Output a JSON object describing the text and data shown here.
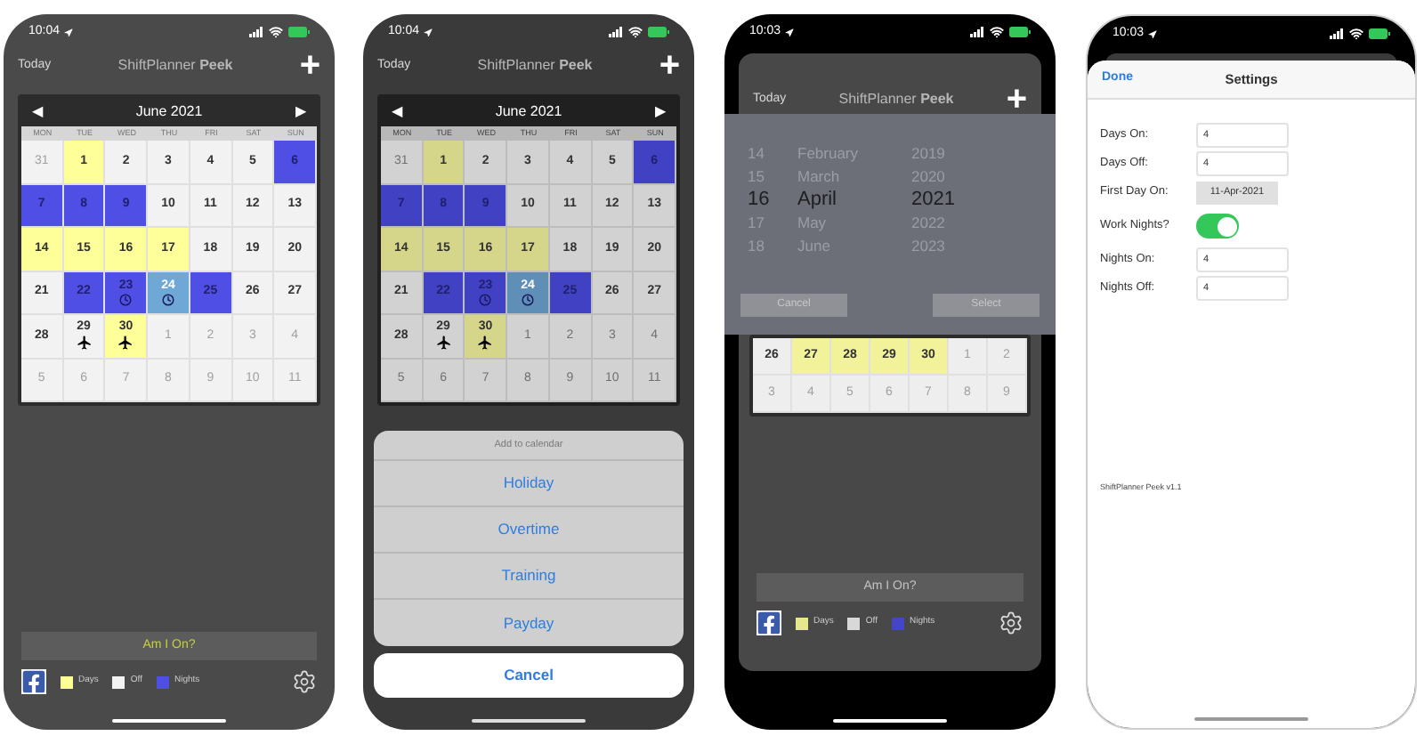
{
  "phones": [
    {
      "kind": "calendar",
      "status": {
        "time": "10:04"
      },
      "nav": {
        "left": "Today",
        "title": "ShiftPlanner **Peek**",
        "right": "+"
      },
      "calendar": {
        "prev": "◀",
        "month": "June 2021",
        "next": "▶",
        "weekdays": [
          "MON",
          "TUE",
          "WED",
          "THU",
          "FRI",
          "SAT",
          "SUN"
        ],
        "cells": [
          {
            "day": "31",
            "color": "#f2f2f2",
            "muted": true
          },
          {
            "day": "1",
            "color": "#ffff99",
            "muted": false
          },
          {
            "day": "2",
            "color": "#f2f2f2",
            "muted": false
          },
          {
            "day": "3",
            "color": "#f2f2f2",
            "muted": false
          },
          {
            "day": "4",
            "color": "#f2f2f2",
            "muted": false
          },
          {
            "day": "5",
            "color": "#f2f2f2",
            "muted": false
          },
          {
            "day": "6",
            "color": "#4f4fe6",
            "muted": false
          },
          {
            "day": "7",
            "color": "#4f4fe6",
            "muted": false
          },
          {
            "day": "8",
            "color": "#4f4fe6",
            "muted": false
          },
          {
            "day": "9",
            "color": "#4f4fe6",
            "muted": false
          },
          {
            "day": "10",
            "color": "#f2f2f2",
            "muted": false
          },
          {
            "day": "11",
            "color": "#f2f2f2",
            "muted": false
          },
          {
            "day": "12",
            "color": "#f2f2f2",
            "muted": false
          },
          {
            "day": "13",
            "color": "#f2f2f2",
            "muted": false
          },
          {
            "day": "14",
            "color": "#ffff99",
            "muted": false
          },
          {
            "day": "15",
            "color": "#ffff99",
            "muted": false
          },
          {
            "day": "16",
            "color": "#ffff99",
            "muted": false
          },
          {
            "day": "17",
            "color": "#ffff99",
            "muted": false
          },
          {
            "day": "18",
            "color": "#f2f2f2",
            "muted": false
          },
          {
            "day": "19",
            "color": "#f2f2f2",
            "muted": false
          },
          {
            "day": "20",
            "color": "#f2f2f2",
            "muted": false
          },
          {
            "day": "21",
            "color": "#f2f2f2",
            "muted": false
          },
          {
            "day": "22",
            "color": "#4f4fe6",
            "muted": false
          },
          {
            "day": "23",
            "color": "#4f4fe6",
            "muted": false,
            "kind": "clock"
          },
          {
            "day": "24",
            "color": "#6fa8d6",
            "muted": false,
            "kind": "clock"
          },
          {
            "day": "25",
            "color": "#4f4fe6",
            "muted": false
          },
          {
            "day": "26",
            "color": "#f2f2f2",
            "muted": false
          },
          {
            "day": "27",
            "color": "#f2f2f2",
            "muted": false
          },
          {
            "day": "28",
            "color": "#f2f2f2",
            "muted": false
          },
          {
            "day": "29",
            "color": "#f2f2f2",
            "muted": false,
            "kind": "plane"
          },
          {
            "day": "30",
            "color": "#ffff99",
            "muted": false,
            "kind": "plane"
          },
          {
            "day": "1",
            "color": "#f2f2f2",
            "muted": true
          },
          {
            "day": "2",
            "color": "#f2f2f2",
            "muted": true
          },
          {
            "day": "3",
            "color": "#f2f2f2",
            "muted": true
          },
          {
            "day": "4",
            "color": "#f2f2f2",
            "muted": true
          },
          {
            "day": "5",
            "color": "#f2f2f2",
            "muted": true
          },
          {
            "day": "6",
            "color": "#f2f2f2",
            "muted": true
          },
          {
            "day": "7",
            "color": "#f2f2f2",
            "muted": true
          },
          {
            "day": "8",
            "color": "#f2f2f2",
            "muted": true
          },
          {
            "day": "9",
            "color": "#f2f2f2",
            "muted": true
          },
          {
            "day": "10",
            "color": "#f2f2f2",
            "muted": true
          },
          {
            "day": "11",
            "color": "#f2f2f2",
            "muted": true
          }
        ]
      },
      "button": "Am I On?",
      "legend": [
        {
          "label": "Days",
          "color": "#ffff99"
        },
        {
          "label": "Off",
          "color": "#f2f2f2"
        },
        {
          "label": "Nights",
          "color": "#4f4fe6"
        }
      ]
    },
    {
      "kind": "action_sheet",
      "status": {
        "time": "10:04"
      },
      "nav": {
        "left": "Today",
        "title": "ShiftPlanner **Peek**",
        "right": "+"
      },
      "calendar": {
        "prev": "◀",
        "month": "June 2021",
        "next": "▶",
        "weekdays": [
          "MON",
          "TUE",
          "WED",
          "THU",
          "FRI",
          "SAT",
          "SUN"
        ],
        "cells": [
          {
            "day": "31",
            "color": "#d2d2d2",
            "muted": true
          },
          {
            "day": "1",
            "color": "#d6d68a",
            "muted": false
          },
          {
            "day": "2",
            "color": "#d2d2d2",
            "muted": false
          },
          {
            "day": "3",
            "color": "#d2d2d2",
            "muted": false
          },
          {
            "day": "4",
            "color": "#d2d2d2",
            "muted": false
          },
          {
            "day": "5",
            "color": "#d2d2d2",
            "muted": false
          },
          {
            "day": "6",
            "color": "#4141c4",
            "muted": false
          },
          {
            "day": "7",
            "color": "#4141c4",
            "muted": false
          },
          {
            "day": "8",
            "color": "#4141c4",
            "muted": false
          },
          {
            "day": "9",
            "color": "#4141c4",
            "muted": false
          },
          {
            "day": "10",
            "color": "#d2d2d2",
            "muted": false
          },
          {
            "day": "11",
            "color": "#d2d2d2",
            "muted": false
          },
          {
            "day": "12",
            "color": "#d2d2d2",
            "muted": false
          },
          {
            "day": "13",
            "color": "#d2d2d2",
            "muted": false
          },
          {
            "day": "14",
            "color": "#d6d68a",
            "muted": false
          },
          {
            "day": "15",
            "color": "#d6d68a",
            "muted": false
          },
          {
            "day": "16",
            "color": "#d6d68a",
            "muted": false
          },
          {
            "day": "17",
            "color": "#d6d68a",
            "muted": false
          },
          {
            "day": "18",
            "color": "#d2d2d2",
            "muted": false
          },
          {
            "day": "19",
            "color": "#d2d2d2",
            "muted": false
          },
          {
            "day": "20",
            "color": "#d2d2d2",
            "muted": false
          },
          {
            "day": "21",
            "color": "#d2d2d2",
            "muted": false
          },
          {
            "day": "22",
            "color": "#4141c4",
            "muted": false
          },
          {
            "day": "23",
            "color": "#4141c4",
            "muted": false,
            "kind": "clock"
          },
          {
            "day": "24",
            "color": "#5f8fb6",
            "muted": false,
            "kind": "clock"
          },
          {
            "day": "25",
            "color": "#4141c4",
            "muted": false
          },
          {
            "day": "26",
            "color": "#d2d2d2",
            "muted": false
          },
          {
            "day": "27",
            "color": "#d2d2d2",
            "muted": false
          },
          {
            "day": "28",
            "color": "#d2d2d2",
            "muted": false
          },
          {
            "day": "29",
            "color": "#d2d2d2",
            "muted": false,
            "kind": "plane"
          },
          {
            "day": "30",
            "color": "#d6d68a",
            "muted": false,
            "kind": "plane"
          },
          {
            "day": "1",
            "color": "#d2d2d2",
            "muted": true
          },
          {
            "day": "2",
            "color": "#d2d2d2",
            "muted": true
          },
          {
            "day": "3",
            "color": "#d2d2d2",
            "muted": true
          },
          {
            "day": "4",
            "color": "#d2d2d2",
            "muted": true
          },
          {
            "day": "5",
            "color": "#d2d2d2",
            "muted": true
          },
          {
            "day": "6",
            "color": "#d2d2d2",
            "muted": true
          },
          {
            "day": "7",
            "color": "#d2d2d2",
            "muted": true
          },
          {
            "day": "8",
            "color": "#d2d2d2",
            "muted": true
          },
          {
            "day": "9",
            "color": "#d2d2d2",
            "muted": true
          },
          {
            "day": "10",
            "color": "#d2d2d2",
            "muted": true
          },
          {
            "day": "11",
            "color": "#d2d2d2",
            "muted": true
          }
        ]
      },
      "sheet": {
        "title": "Add to calendar",
        "options": [
          "Holiday",
          "Overtime",
          "Training",
          "Payday"
        ],
        "cancel": "Cancel"
      }
    },
    {
      "kind": "date_picker",
      "status": {
        "time": "10:03"
      },
      "nav": {
        "left": "Today",
        "title": "ShiftPlanner **Peek**",
        "right": "+"
      },
      "picker": {
        "columns": [
          {
            "items": [
              {
                "label": "14",
                "selected": false
              },
              {
                "label": "15",
                "selected": false
              },
              {
                "label": "16",
                "selected": true
              },
              {
                "label": "17",
                "selected": false
              },
              {
                "label": "18",
                "selected": false
              }
            ]
          },
          {
            "items": [
              {
                "label": "February",
                "selected": false
              },
              {
                "label": "March",
                "selected": false
              },
              {
                "label": "April",
                "selected": true
              },
              {
                "label": "May",
                "selected": false
              },
              {
                "label": "June",
                "selected": false
              }
            ]
          },
          {
            "items": [
              {
                "label": "2019",
                "selected": false
              },
              {
                "label": "2020",
                "selected": false
              },
              {
                "label": "2021",
                "selected": true
              },
              {
                "label": "2022",
                "selected": false
              },
              {
                "label": "2023",
                "selected": false
              }
            ]
          }
        ],
        "cancel": "Cancel",
        "select": "Select"
      },
      "calendar": {
        "cells": [
          {
            "day": "26",
            "color": "#eeeeee",
            "muted": false
          },
          {
            "day": "27",
            "color": "#f2f29a",
            "muted": false
          },
          {
            "day": "28",
            "color": "#f2f29a",
            "muted": false
          },
          {
            "day": "29",
            "color": "#f2f29a",
            "muted": false
          },
          {
            "day": "30",
            "color": "#f2f29a",
            "muted": false
          },
          {
            "day": "1",
            "color": "#eeeeee",
            "muted": true
          },
          {
            "day": "2",
            "color": "#eeeeee",
            "muted": true
          },
          {
            "day": "3",
            "color": "#eeeeee",
            "muted": true
          },
          {
            "day": "4",
            "color": "#eeeeee",
            "muted": true
          },
          {
            "day": "5",
            "color": "#eeeeee",
            "muted": true
          },
          {
            "day": "6",
            "color": "#eeeeee",
            "muted": true
          },
          {
            "day": "7",
            "color": "#eeeeee",
            "muted": true
          },
          {
            "day": "8",
            "color": "#eeeeee",
            "muted": true
          },
          {
            "day": "9",
            "color": "#eeeeee",
            "muted": true
          }
        ]
      },
      "button": "Am I On?",
      "legend": [
        {
          "label": "Days",
          "color": "#e6e68c"
        },
        {
          "label": "Off",
          "color": "#d8d8d8"
        },
        {
          "label": "Nights",
          "color": "#4545c8"
        }
      ]
    },
    {
      "kind": "settings",
      "status": {
        "time": "10:03"
      },
      "nav": {
        "left": "Done",
        "title": "Settings"
      },
      "fields": [
        {
          "kind": "number",
          "label": "Days On:",
          "value": "4"
        },
        {
          "kind": "number",
          "label": "Days Off:",
          "value": "4"
        },
        {
          "kind": "date",
          "label": "First Day On:",
          "value": "11-Apr-2021"
        },
        {
          "kind": "toggle",
          "label": "Work Nights?",
          "on": true
        },
        {
          "kind": "number",
          "label": "Nights On:",
          "value": "4"
        },
        {
          "kind": "number",
          "label": "Nights Off:",
          "value": "4"
        }
      ],
      "version": "ShiftPlanner Peek v1.1"
    }
  ]
}
